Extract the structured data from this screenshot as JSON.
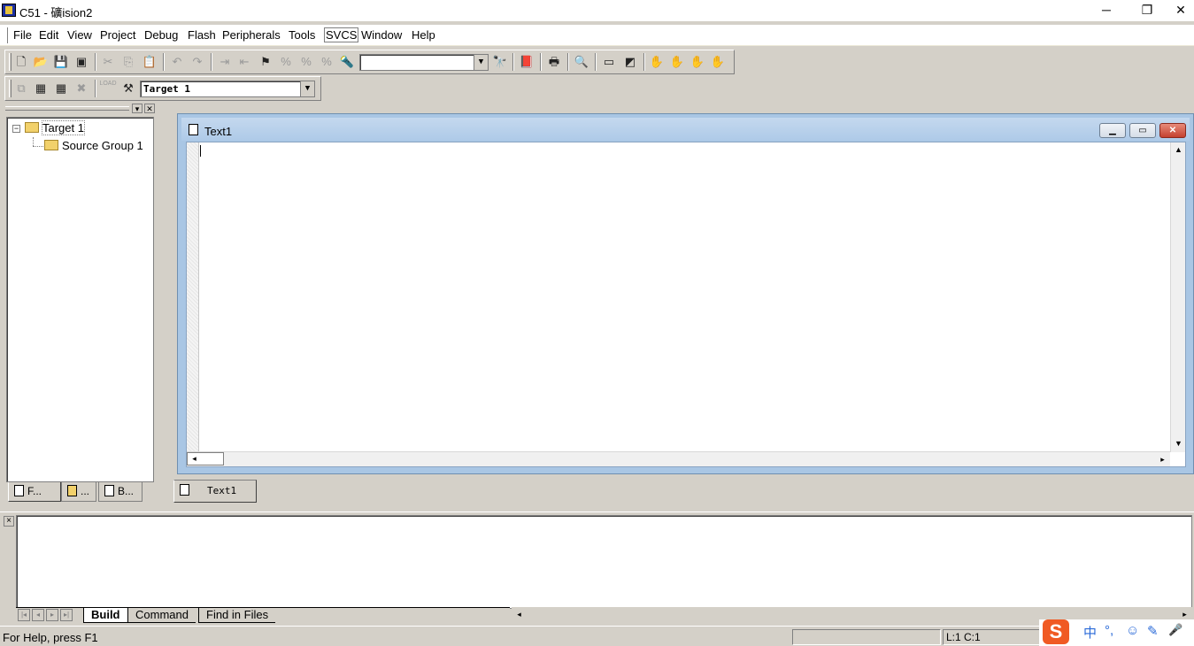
{
  "window": {
    "title": "C51  - 礦ision2",
    "minimize": "─",
    "maximize": "❐",
    "close": "✕"
  },
  "menu": [
    {
      "label": "File"
    },
    {
      "label": "Edit"
    },
    {
      "label": "View"
    },
    {
      "label": "Project"
    },
    {
      "label": "Debug"
    },
    {
      "label": "Flash"
    },
    {
      "label": "Peripherals"
    },
    {
      "label": "Tools"
    },
    {
      "label": "SVCS"
    },
    {
      "label": "Window"
    },
    {
      "label": "Help"
    }
  ],
  "toolbar": {
    "find_combo_value": "",
    "target_combo_value": "Target 1",
    "load_label": "LOAD",
    "combo_arrow": "▼"
  },
  "project_tree": {
    "expander": "−",
    "root": "Target 1",
    "group": "Source Group 1"
  },
  "left_tabs": [
    {
      "label": "F..."
    },
    {
      "label": "..."
    },
    {
      "label": "B..."
    }
  ],
  "editor": {
    "title": "Text1",
    "tab_label": "Text1"
  },
  "output": {
    "tabs": [
      {
        "label": "Build"
      },
      {
        "label": "Command"
      },
      {
        "label": "Find in Files"
      }
    ],
    "close": "×"
  },
  "status": {
    "help": "For Help, press F1",
    "position": "L:1 C:1"
  },
  "ime": {
    "logo": "S",
    "lang": "中",
    "punct": "°,",
    "emoji": "☺",
    "pen": "✎",
    "mic": "🎤"
  }
}
